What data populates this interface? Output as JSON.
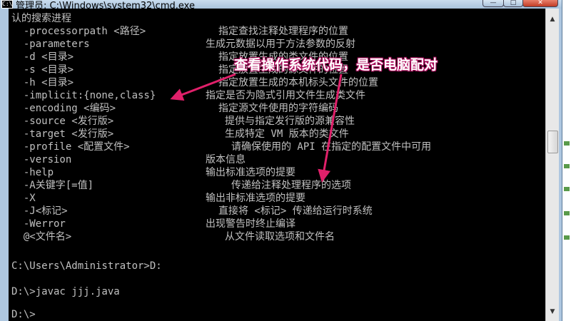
{
  "window": {
    "title": "管理员: C:\\Windows\\system32\\cmd.exe",
    "icon_label": "C:\\",
    "buttons": {
      "minimize": "—",
      "maximize": "□",
      "close": "✕"
    }
  },
  "console": {
    "lines": [
      {
        "text": "认的搜索进程",
        "desc": ""
      },
      {
        "text": "  -processorpath <路径>",
        "desc": "指定查找注释处理程序的位置"
      },
      {
        "text": "  -parameters",
        "desc": "生成元数据以用于方法参数的反射"
      },
      {
        "text": "  -d <目录>",
        "desc": "指定放置生成的类文件的位置"
      },
      {
        "text": "  -s <目录>",
        "desc": "指定放置生成的源文件的位置"
      },
      {
        "text": "  -h <目录>",
        "desc": "指定放置生成的本机标头文件的位置"
      },
      {
        "text": "  -implicit:{none,class}",
        "desc": "指定是否为隐式引用文件生成类文件"
      },
      {
        "text": "  -encoding <编码>",
        "desc": "指定源文件使用的字符编码"
      },
      {
        "text": "  -source <发行版>",
        "desc": "提供与指定发行版的源兼容性"
      },
      {
        "text": "  -target <发行版>",
        "desc": "生成特定 VM 版本的类文件"
      },
      {
        "text": "  -profile <配置文件>",
        "desc": "请确保使用的 API 在指定的配置文件中可用"
      },
      {
        "text": "  -version",
        "desc": "版本信息"
      },
      {
        "text": "  -help",
        "desc": "输出标准选项的提要"
      },
      {
        "text": "  -A关键字[=值]",
        "desc": "传递给注释处理程序的选项"
      },
      {
        "text": "  -X",
        "desc": "输出非标准选项的提要"
      },
      {
        "text": "  -J<标记>",
        "desc": "直接将 <标记> 传递给运行时系统"
      },
      {
        "text": "  -Werror",
        "desc": "出现警告时终止编译"
      },
      {
        "text": "  @<文件名>",
        "desc": "从文件读取选项和文件名"
      }
    ],
    "prompts": [
      "C:\\Users\\Administrator>D:",
      "D:\\>javac jjj.java",
      "D:\\>"
    ]
  },
  "annotation": {
    "text": "查看操作系统代码，是否电脑配对",
    "color": "#e0206a"
  },
  "scrollbar": {
    "up_arrow": "▲",
    "down_arrow": "▼"
  }
}
